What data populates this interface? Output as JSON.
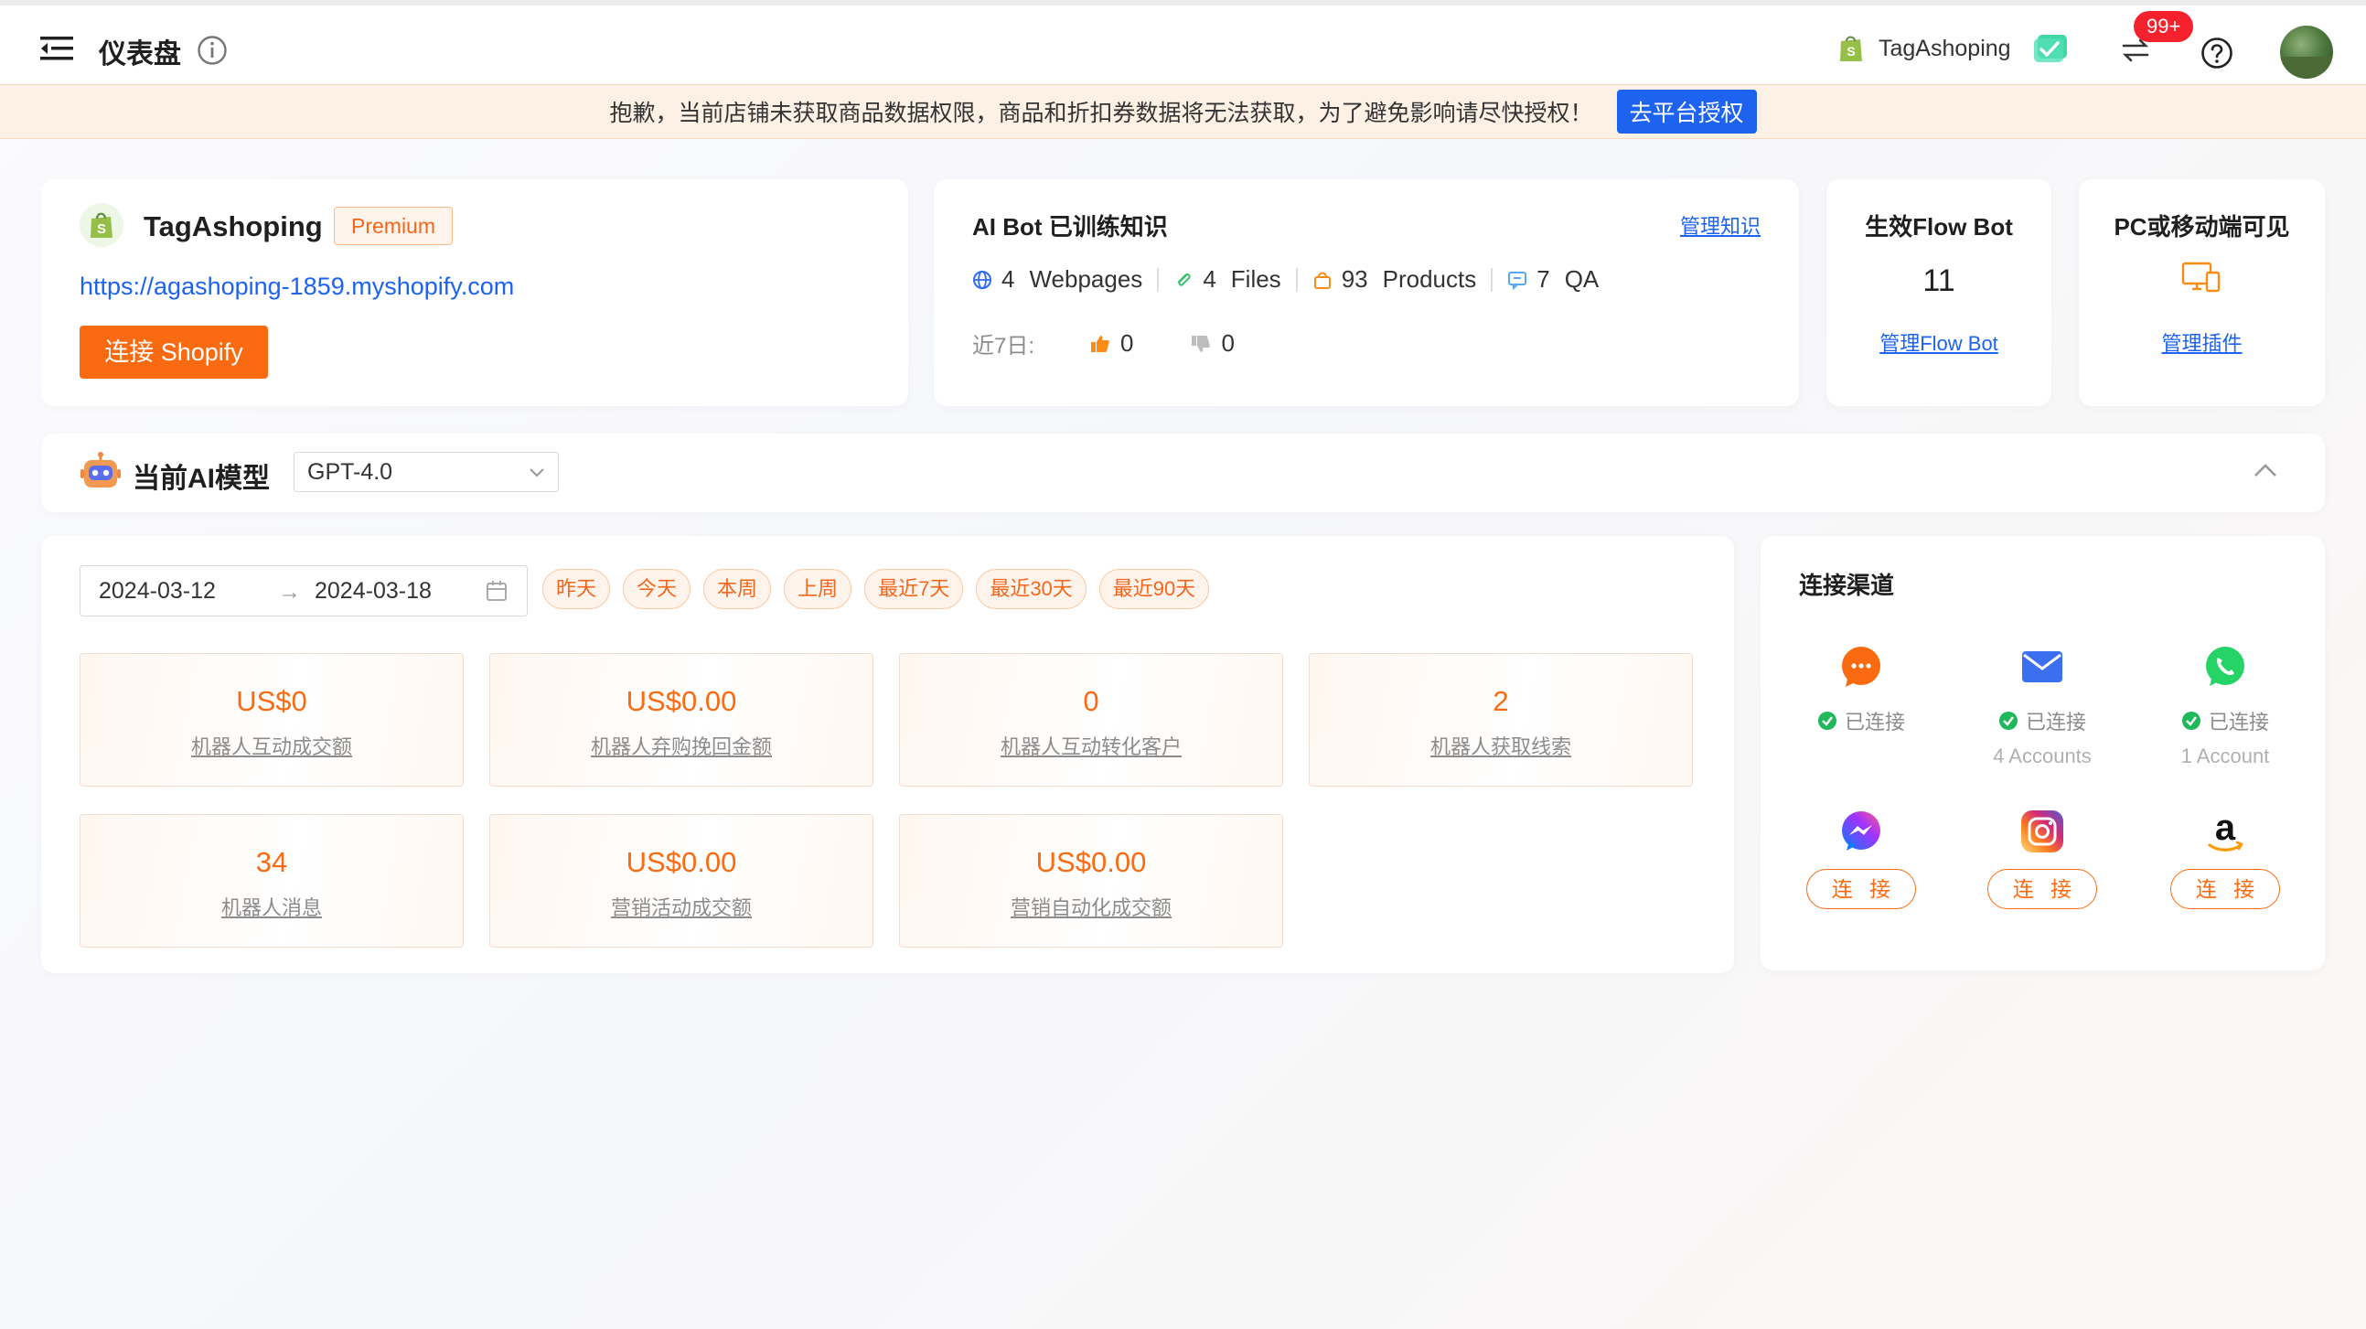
{
  "header": {
    "title": "仪表盘",
    "store_name": "TagAshoping",
    "notification_count": "99+"
  },
  "banner": {
    "text": "抱歉，当前店铺未获取商品数据权限，商品和折扣券数据将无法获取，为了避免影响请尽快授权！",
    "button_label": "去平台授权"
  },
  "store_card": {
    "name": "TagAshoping",
    "plan": "Premium",
    "url": "https://agashoping-1859.myshopify.com",
    "connect_label": "连接 Shopify"
  },
  "knowledge": {
    "title": "AI Bot 已训练知识",
    "manage_label": "管理知识",
    "stats": [
      {
        "icon": "globe-icon",
        "count": "4",
        "label": "Webpages"
      },
      {
        "icon": "attachment-icon",
        "count": "4",
        "label": "Files"
      },
      {
        "icon": "shopping-bag-icon",
        "count": "93",
        "label": "Products"
      },
      {
        "icon": "qa-icon",
        "count": "7",
        "label": "QA"
      }
    ],
    "week_label": "近7日:",
    "thumbs_up": "0",
    "thumbs_down": "0"
  },
  "flow_bot": {
    "title": "生效Flow Bot",
    "count": "11",
    "manage_label": "管理Flow Bot"
  },
  "visibility": {
    "title": "PC或移动端可见",
    "manage_label": "管理插件"
  },
  "model": {
    "label": "当前AI模型",
    "selected": "GPT-4.0"
  },
  "metrics": {
    "date_start": "2024-03-12",
    "date_end": "2024-03-18",
    "date_arrow": "→",
    "quick_ranges": [
      "昨天",
      "今天",
      "本周",
      "上周",
      "最近7天",
      "最近30天",
      "最近90天"
    ],
    "boxes": [
      {
        "value": "US$0",
        "label": "机器人互动成交额"
      },
      {
        "value": "US$0.00",
        "label": "机器人弃购挽回金额"
      },
      {
        "value": "0",
        "label": "机器人互动转化客户"
      },
      {
        "value": "2",
        "label": "机器人获取线索"
      },
      {
        "value": "34",
        "label": "机器人消息"
      },
      {
        "value": "US$0.00",
        "label": "营销活动成交额"
      },
      {
        "value": "US$0.00",
        "label": "营销自动化成交额"
      }
    ]
  },
  "channels": {
    "title": "连接渠道",
    "connected_label": "已连接",
    "connect_label": "连 接",
    "items": [
      {
        "name": "livechat-icon",
        "status": "已连接",
        "accounts": ""
      },
      {
        "name": "email-icon",
        "status": "已连接",
        "accounts": "4 Accounts"
      },
      {
        "name": "whatsapp-icon",
        "status": "已连接",
        "accounts": "1 Account"
      },
      {
        "name": "messenger-icon",
        "button": "连 接"
      },
      {
        "name": "instagram-icon",
        "button": "连 接"
      },
      {
        "name": "amazon-icon",
        "button": "连 接"
      }
    ]
  },
  "colors": {
    "accent_orange": "#fa6a10",
    "link_blue": "#1d63f0",
    "success_green": "#1fb85b",
    "badge_red": "#f5222d"
  }
}
